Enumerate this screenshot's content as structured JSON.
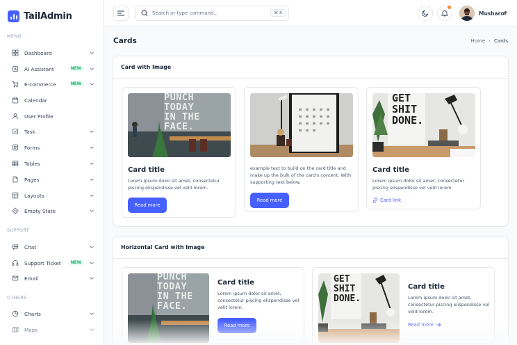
{
  "app": {
    "name": "TailAdmin",
    "brand_color": "#465fff"
  },
  "sidebar": {
    "sections": [
      {
        "label": "MENU",
        "items": [
          {
            "label": "Dashboard",
            "icon": "grid-icon",
            "chevron": true,
            "badge": ""
          },
          {
            "label": "AI Assistant",
            "icon": "ai-icon",
            "chevron": true,
            "badge": "NEW"
          },
          {
            "label": "E-commerce",
            "icon": "cart-icon",
            "chevron": true,
            "badge": "NEW"
          },
          {
            "label": "Calendar",
            "icon": "calendar-icon",
            "chevron": false,
            "badge": ""
          },
          {
            "label": "User Profile",
            "icon": "user-icon",
            "chevron": false,
            "badge": ""
          },
          {
            "label": "Task",
            "icon": "task-icon",
            "chevron": true,
            "badge": ""
          },
          {
            "label": "Forms",
            "icon": "forms-icon",
            "chevron": true,
            "badge": ""
          },
          {
            "label": "Tables",
            "icon": "table-icon",
            "chevron": true,
            "badge": ""
          },
          {
            "label": "Pages",
            "icon": "pages-icon",
            "chevron": true,
            "badge": ""
          },
          {
            "label": "Layouts",
            "icon": "layouts-icon",
            "chevron": true,
            "badge": ""
          },
          {
            "label": "Empty State",
            "icon": "empty-state-icon",
            "chevron": true,
            "badge": ""
          }
        ]
      },
      {
        "label": "SUPPORT",
        "items": [
          {
            "label": "Chat",
            "icon": "chat-icon",
            "chevron": true,
            "badge": ""
          },
          {
            "label": "Support Ticket",
            "icon": "headset-icon",
            "chevron": true,
            "badge": "NEW"
          },
          {
            "label": "Email",
            "icon": "mail-icon",
            "chevron": true,
            "badge": ""
          }
        ]
      },
      {
        "label": "OTHERS",
        "items": [
          {
            "label": "Charts",
            "icon": "pie-chart-icon",
            "chevron": true,
            "badge": ""
          },
          {
            "label": "Maps",
            "icon": "map-icon",
            "chevron": true,
            "badge": ""
          }
        ]
      }
    ]
  },
  "header": {
    "search_placeholder": "Search or type command...",
    "search_shortcut": "⌘ K",
    "user_name": "Musharof"
  },
  "page": {
    "title": "Cards",
    "breadcrumb": {
      "home": "Home",
      "separator": "›",
      "current": "Cards"
    }
  },
  "section1": {
    "title": "Card with Image",
    "cards": [
      {
        "image": "punch-today-wall-photo",
        "image_text": [
          "PUNCH",
          "TODAY",
          "IN THE",
          "FACE."
        ],
        "title": "Card title",
        "text": "Lorem ipsum dolor sit amet, consectetur piscing elispendisse vel velit lorem.",
        "button": "Read more"
      },
      {
        "image": "desk-calendar-photo",
        "text": "example text to build on the card title and make up the bulk of the card's content. With supporting text below.",
        "button": "Read more"
      },
      {
        "image": "get-shit-done-poster-photo",
        "image_text": [
          "GET",
          "SHIT",
          "DONE."
        ],
        "title": "Card title",
        "text": "Lorem ipsum dolor sit amet, consectetur piscing elispendisse vel velit lorem.",
        "link": "Card link"
      }
    ]
  },
  "section2": {
    "title": "Horizontal Card with Image",
    "cards": [
      {
        "image": "punch-today-wall-photo",
        "image_text": [
          "PUNCH",
          "TODAY",
          "IN THE",
          "FACE."
        ],
        "title": "Card title",
        "text": "Lorem ipsum dolor sit amet, consectetur piscing elispendisse vel velit lorem.",
        "button": "Read more"
      },
      {
        "image": "get-shit-done-poster-photo",
        "image_text": [
          "GET",
          "SHIT",
          "DONE."
        ],
        "title": "Card title",
        "text": "Lorem ipsum dolor sit amet, consectetur piscing elispendisse vel velit lorem.",
        "link": "Read more"
      }
    ]
  }
}
